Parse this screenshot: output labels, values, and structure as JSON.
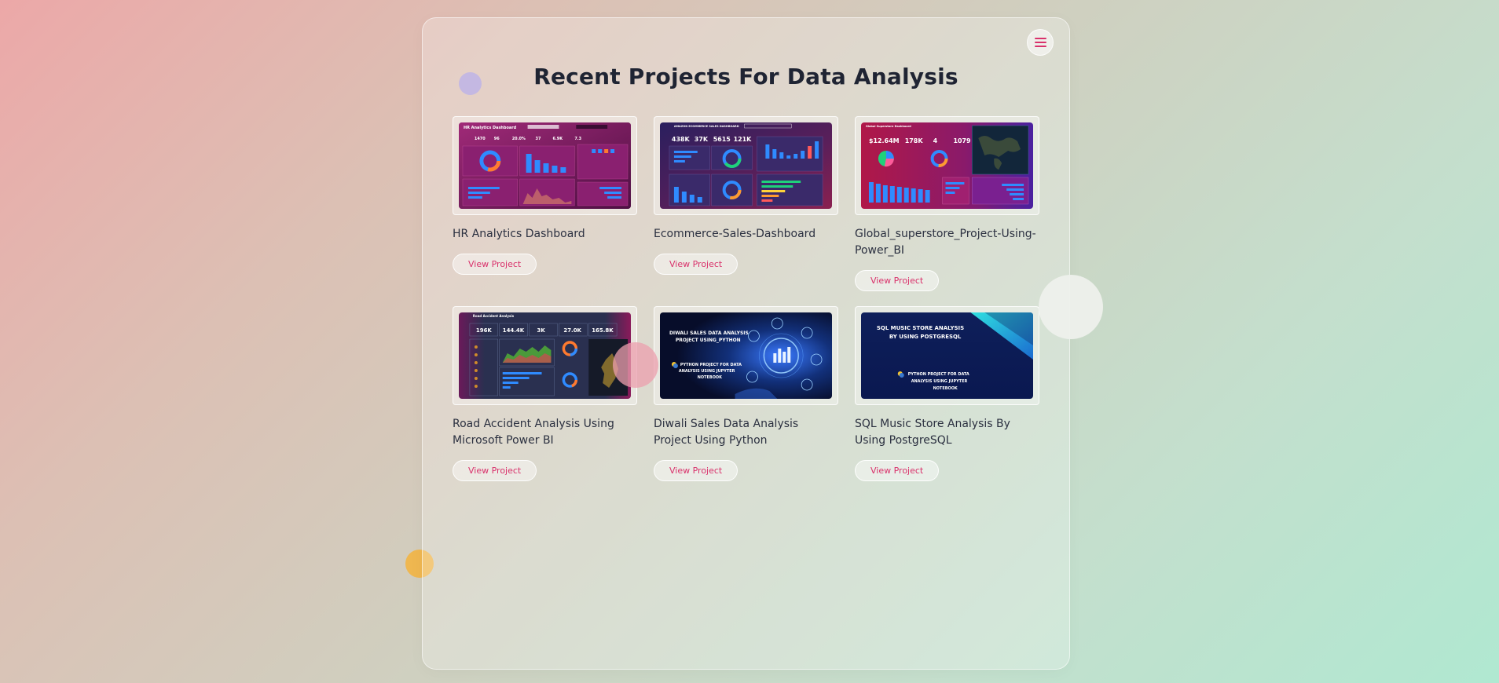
{
  "page": {
    "title": "Recent Projects For Data Analysis",
    "menu_icon": "hamburger-menu-icon",
    "accent_color": "#d9316b"
  },
  "projects": [
    {
      "name": "HR Analytics Dashboard",
      "button": "View Project",
      "thumbnail": {
        "heading": "HR Analytics Dashboard",
        "kpis": [
          "1470",
          "96",
          "20.0%",
          "37",
          "6.9K",
          "7.3"
        ]
      }
    },
    {
      "name": "Ecommerce-Sales-Dashboard",
      "button": "View Project",
      "thumbnail": {
        "heading": "AMAZON ECOMMERCE SALES DASHBOARD",
        "kpis": [
          "438K",
          "37K",
          "5615",
          "121K"
        ]
      }
    },
    {
      "name": "Global_superstore_Project-Using-Power_BI",
      "button": "View Project",
      "thumbnail": {
        "heading": "Global Superstore Dashboard",
        "kpis": [
          "$12.64M",
          "178K",
          "4",
          "1079"
        ]
      }
    },
    {
      "name": "Road Accident Analysis Using Microsoft Power BI",
      "button": "View Project",
      "thumbnail": {
        "heading": "Road Accident Analysis",
        "kpis": [
          "196K",
          "144.4K",
          "3K",
          "27.0K",
          "165.8K"
        ]
      }
    },
    {
      "name": "Diwali Sales Data Analysis Project Using Python",
      "button": "View Project",
      "thumbnail": {
        "heading_line1": "DIWALI SALES DATA ANALYSIS",
        "heading_line2": "PROJECT USING_PYTHON",
        "sub_line1": "PYTHON PROJECT FOR DATA",
        "sub_line2": "ANALYSIS USING JUPYTER",
        "sub_line3": "NOTEBOOK"
      }
    },
    {
      "name": "SQL Music Store Analysis By Using PostgreSQL",
      "button": "View Project",
      "thumbnail": {
        "heading_line1": "SQL MUSIC STORE ANALYSIS",
        "heading_line2": "BY USING POSTGRESQL",
        "sub_line1": "PYTHON PROJECT FOR DATA",
        "sub_line2": "ANALYSIS USING JUPYTER",
        "sub_line3": "NOTEBOOK"
      }
    }
  ]
}
